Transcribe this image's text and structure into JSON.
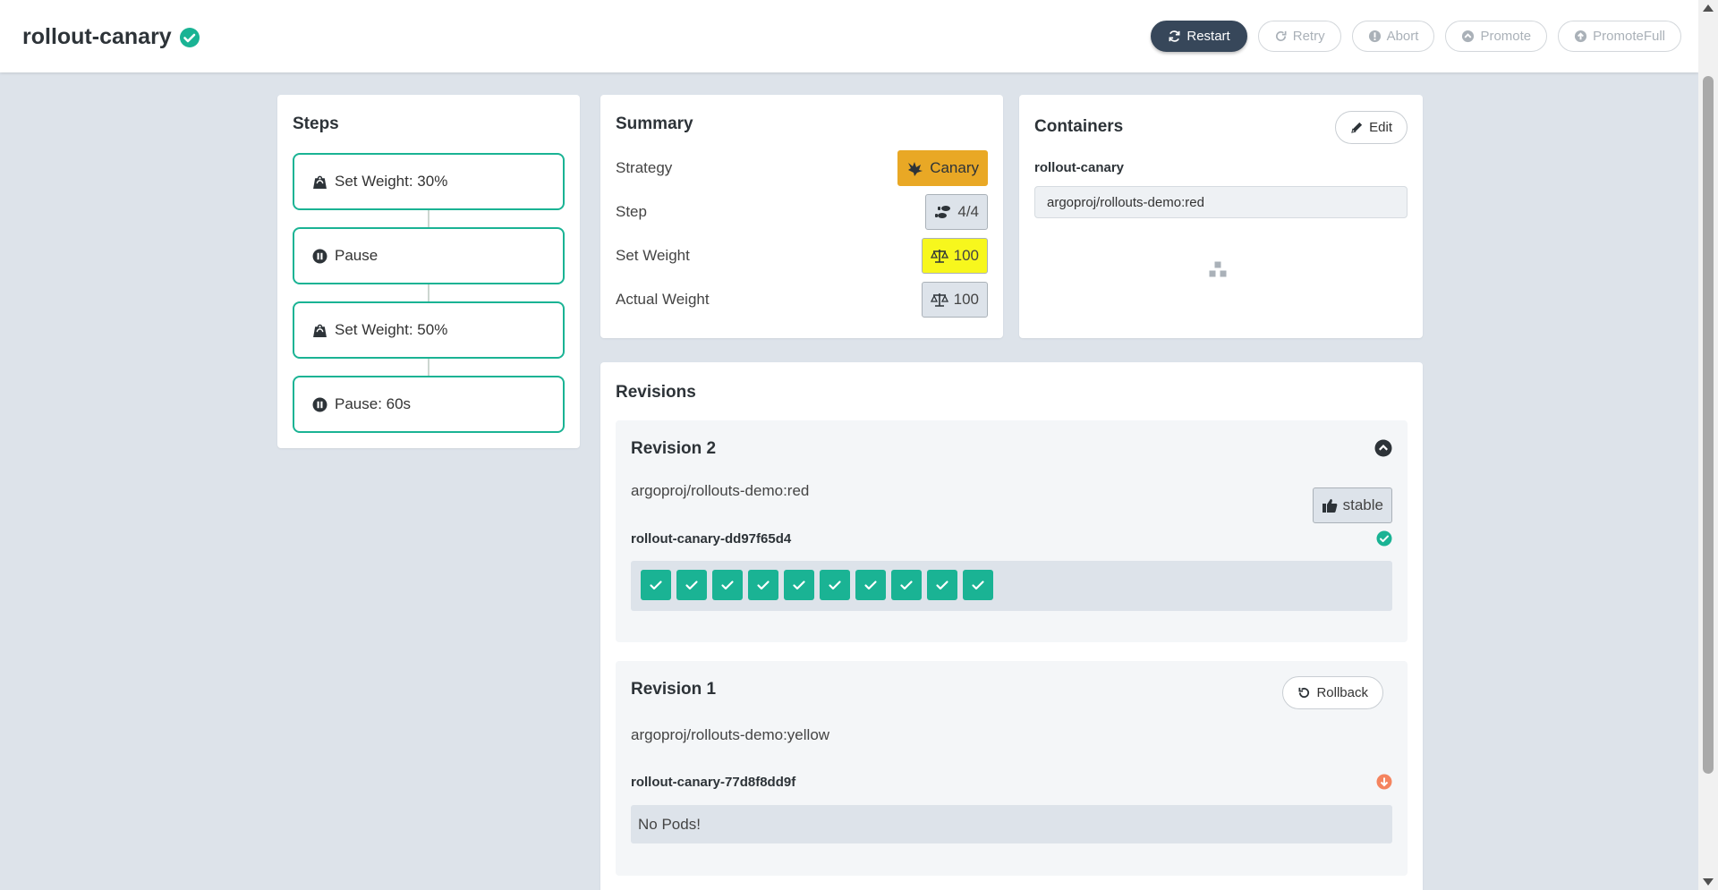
{
  "header": {
    "title": "rollout-canary",
    "actions": {
      "restart": "Restart",
      "retry": "Retry",
      "abort": "Abort",
      "promote": "Promote",
      "promote_full": "PromoteFull"
    }
  },
  "steps": {
    "title": "Steps",
    "items": [
      {
        "label": "Set Weight: 30%",
        "icon": "weight-icon"
      },
      {
        "label": "Pause",
        "icon": "pause-icon"
      },
      {
        "label": "Set Weight: 50%",
        "icon": "weight-icon"
      },
      {
        "label": "Pause: 60s",
        "icon": "pause-icon"
      }
    ]
  },
  "summary": {
    "title": "Summary",
    "rows": [
      {
        "label": "Strategy",
        "value": "Canary"
      },
      {
        "label": "Step",
        "value": "4/4"
      },
      {
        "label": "Set Weight",
        "value": "100"
      },
      {
        "label": "Actual Weight",
        "value": "100"
      }
    ]
  },
  "containers": {
    "title": "Containers",
    "edit_label": "Edit",
    "name": "rollout-canary",
    "image": "argoproj/rollouts-demo:red"
  },
  "revisions": {
    "title": "Revisions",
    "items": [
      {
        "title": "Revision 2",
        "image": "argoproj/rollouts-demo:red",
        "badge": "stable",
        "replicaset": "rollout-canary-dd97f65d4",
        "pod_count": 10
      },
      {
        "title": "Revision 1",
        "image": "argoproj/rollouts-demo:yellow",
        "rollback_label": "Rollback",
        "replicaset": "rollout-canary-77d8f8dd9f",
        "pods_text": "No Pods!"
      }
    ]
  },
  "colors": {
    "accent": "#1ab394",
    "primary_button": "#37475a",
    "canary": "#e9a825",
    "highlight": "#f7f71d",
    "scaled_down": "#f4845f"
  }
}
